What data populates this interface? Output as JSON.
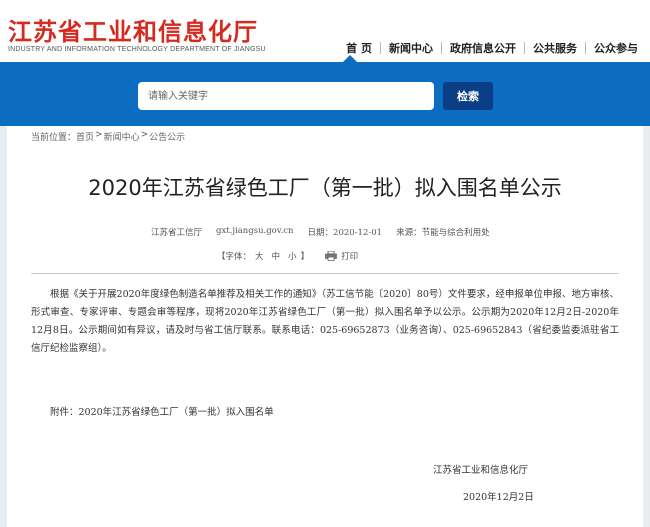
{
  "header": {
    "logo_cn": "江苏省工业和信息化厅",
    "logo_en": "INDUSTRY AND INFORMATION TECHNOLOGY DEPARTMENT OF JIANGSU",
    "nav": [
      "首 页",
      "新闻中心",
      "政府信息公开",
      "公共服务",
      "公众参与"
    ]
  },
  "search": {
    "placeholder": "请输入关键字",
    "button_label": "检索"
  },
  "breadcrumb": {
    "prefix": "当前位置：",
    "items": [
      "首页",
      "新闻中心",
      "公告公示"
    ],
    "separator": ">"
  },
  "article": {
    "title": "2020年江苏省绿色工厂（第一批）拟入围名单公示",
    "source": "江苏省工信厅",
    "site": "gxt.jiangsu.gov.cn",
    "date": "日期：2020-12-01",
    "origin": "来源：节能与综合利用处",
    "font_label": "【字体：",
    "font_sizes": [
      "大",
      "中",
      "小"
    ],
    "font_close": "】",
    "print_label": "打印",
    "body": "根据《关于开展2020年度绿色制造名单推荐及相关工作的通知》（苏工信节能〔2020〕80号）文件要求，经申报单位申报、地方审核、形式审查、专家评审、专题会审等程序，现将2020年江苏省绿色工厂（第一批）拟入围名单予以公示。公示期为2020年12月2日-2020年12月8日。公示期间如有异议，请及时与省工信厅联系。联系电话：025-69652873（业务咨询）、025-69652843（省纪委监委派驻省工信厅纪检监察组）。",
    "attachment": "附件：2020年江苏省绿色工厂（第一批）拟入围名单",
    "signature_org": "江苏省工业和信息化厅",
    "signature_date": "2020年12月2日"
  }
}
